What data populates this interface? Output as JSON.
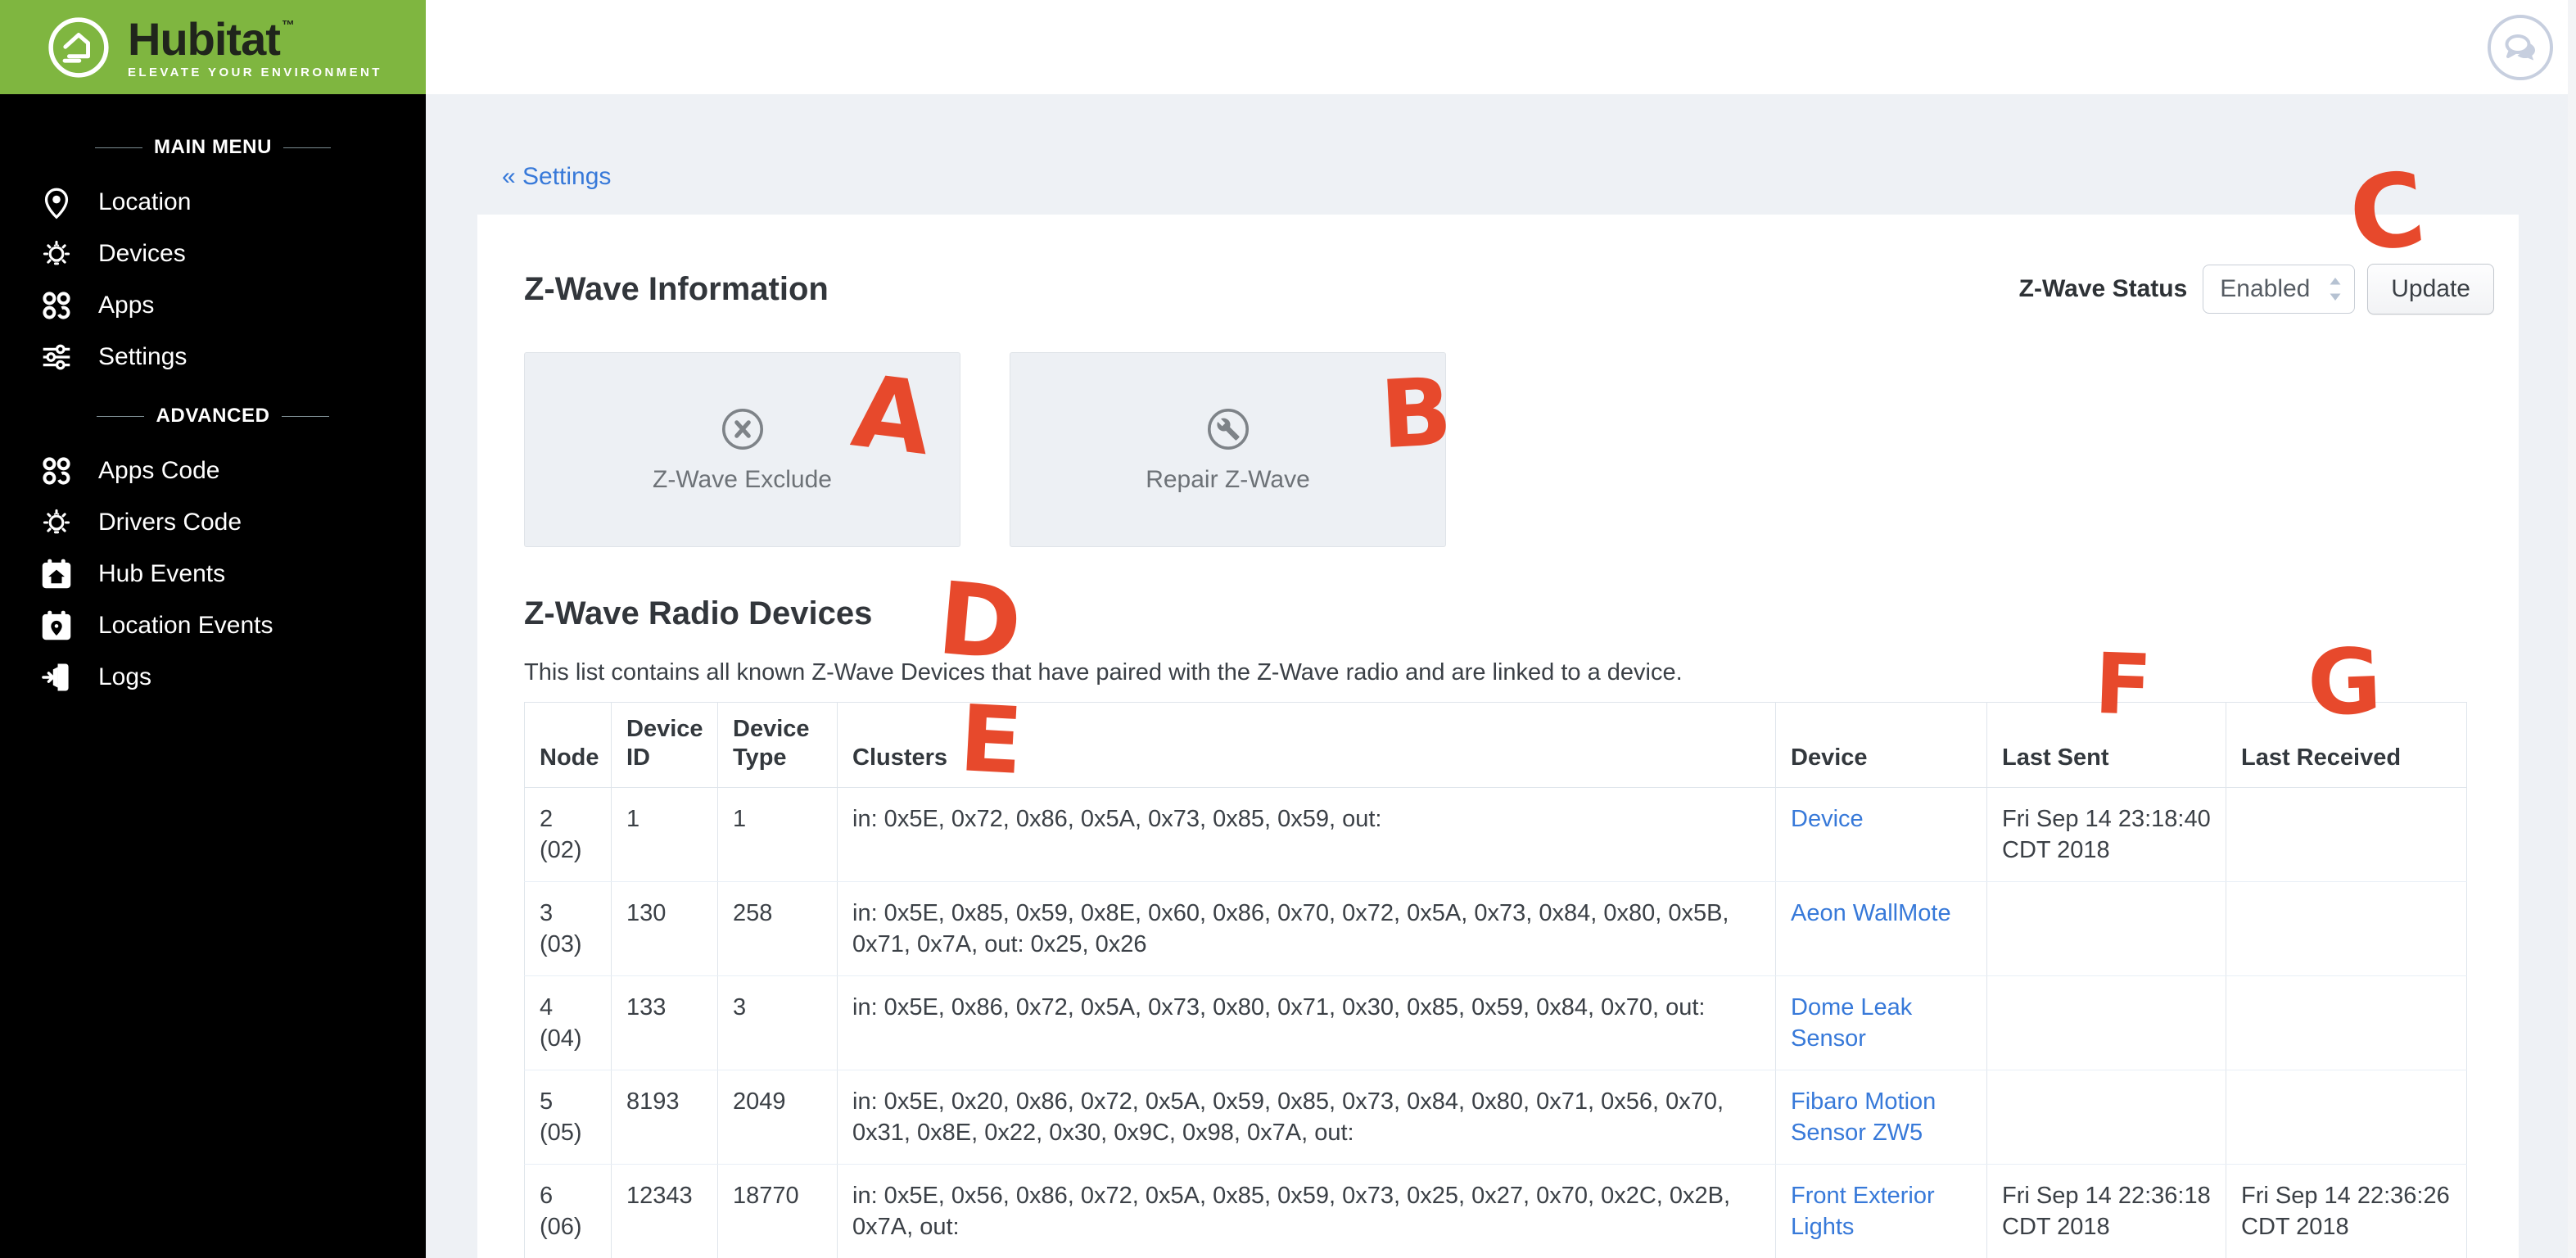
{
  "brand": {
    "name": "Hubitat",
    "trademark": "™",
    "tagline": "ELEVATE YOUR ENVIRONMENT"
  },
  "topbar": {
    "chat_icon": "chat-bubbles-icon"
  },
  "sidebar": {
    "sections": [
      {
        "label": "MAIN MENU",
        "items": [
          {
            "icon": "location-pin-icon",
            "label": "Location"
          },
          {
            "icon": "devices-bulb-icon",
            "label": "Devices"
          },
          {
            "icon": "apps-circles-icon",
            "label": "Apps"
          },
          {
            "icon": "settings-sliders-icon",
            "label": "Settings"
          }
        ]
      },
      {
        "label": "ADVANCED",
        "items": [
          {
            "icon": "apps-circles-icon",
            "label": "Apps Code"
          },
          {
            "icon": "devices-bulb-icon",
            "label": "Drivers Code"
          },
          {
            "icon": "calendar-house-icon",
            "label": "Hub Events"
          },
          {
            "icon": "calendar-pin-icon",
            "label": "Location Events"
          },
          {
            "icon": "door-exit-icon",
            "label": "Logs"
          }
        ]
      }
    ]
  },
  "breadcrumb": {
    "back_label": "« Settings"
  },
  "page": {
    "title": "Z-Wave Information",
    "status": {
      "label": "Z-Wave Status",
      "selected": "Enabled",
      "update_label": "Update"
    },
    "actions": [
      {
        "icon": "circle-x-icon",
        "label": "Z-Wave Exclude"
      },
      {
        "icon": "circle-wrench-icon",
        "label": "Repair Z-Wave"
      }
    ],
    "radio_devices": {
      "title": "Z-Wave Radio Devices",
      "description": "This list contains all known Z-Wave Devices that have paired with the Z-Wave radio and are linked to a device.",
      "table": {
        "columns": [
          "Node",
          "Device ID",
          "Device Type",
          "Clusters",
          "Device",
          "Last Sent",
          "Last Received"
        ],
        "rows": [
          {
            "node": "2 (02)",
            "device_id": "1",
            "device_type": "1",
            "clusters": "in: 0x5E, 0x72, 0x86, 0x5A, 0x73, 0x85, 0x59, out:",
            "device": "Device",
            "last_sent": "Fri Sep 14 23:18:40 CDT 2018",
            "last_received": ""
          },
          {
            "node": "3 (03)",
            "device_id": "130",
            "device_type": "258",
            "clusters": "in: 0x5E, 0x85, 0x59, 0x8E, 0x60, 0x86, 0x70, 0x72, 0x5A, 0x73, 0x84, 0x80, 0x5B, 0x71, 0x7A, out: 0x25, 0x26",
            "device": "Aeon WallMote",
            "last_sent": "",
            "last_received": ""
          },
          {
            "node": "4 (04)",
            "device_id": "133",
            "device_type": "3",
            "clusters": "in: 0x5E, 0x86, 0x72, 0x5A, 0x73, 0x80, 0x71, 0x30, 0x85, 0x59, 0x84, 0x70, out:",
            "device": "Dome Leak Sensor",
            "last_sent": "",
            "last_received": ""
          },
          {
            "node": "5 (05)",
            "device_id": "8193",
            "device_type": "2049",
            "clusters": "in: 0x5E, 0x20, 0x86, 0x72, 0x5A, 0x59, 0x85, 0x73, 0x84, 0x80, 0x71, 0x56, 0x70, 0x31, 0x8E, 0x22, 0x30, 0x9C, 0x98, 0x7A, out:",
            "device": "Fibaro Motion Sensor ZW5",
            "last_sent": "",
            "last_received": ""
          },
          {
            "node": "6 (06)",
            "device_id": "12343",
            "device_type": "18770",
            "clusters": "in: 0x5E, 0x56, 0x86, 0x72, 0x5A, 0x85, 0x59, 0x73, 0x25, 0x27, 0x70, 0x2C, 0x2B, 0x7A, out:",
            "device": "Front Exterior Lights",
            "last_sent": "Fri Sep 14 22:36:18 CDT 2018",
            "last_received": "Fri Sep 14 22:36:26 CDT 2018"
          }
        ]
      }
    }
  },
  "annotations": {
    "letters": [
      "A",
      "B",
      "C",
      "D",
      "E",
      "F",
      "G"
    ]
  },
  "colors": {
    "brand_green": "#7fb640",
    "sidebar_black": "#000000",
    "link_blue": "#3779d9",
    "annotation_red": "#e7492c",
    "page_background": "#eef1f5"
  }
}
